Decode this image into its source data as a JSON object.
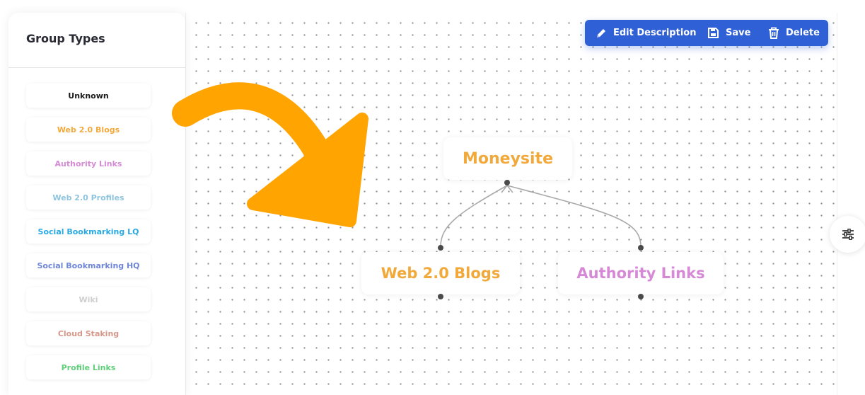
{
  "sidebar": {
    "title": "Group Types",
    "items": [
      {
        "label": "Unknown",
        "color": "#1a1a1a"
      },
      {
        "label": "Web 2.0 Blogs",
        "color": "#f2a93b"
      },
      {
        "label": "Authority Links",
        "color": "#d68ad6"
      },
      {
        "label": "Web 2.0 Profiles",
        "color": "#8ec4dd"
      },
      {
        "label": "Social Bookmarking LQ",
        "color": "#2aa9e0"
      },
      {
        "label": "Social Bookmarking HQ",
        "color": "#6f86d6"
      },
      {
        "label": "Wiki",
        "color": "#cfcfcf"
      },
      {
        "label": "Cloud Staking",
        "color": "#d4978a"
      },
      {
        "label": "Profile Links",
        "color": "#5fcf7a"
      }
    ]
  },
  "toolbar": {
    "edit_label": "Edit Description",
    "save_label": "Save",
    "delete_label": "Delete",
    "color": "#3060d6"
  },
  "nodes": {
    "moneysite": {
      "label": "Moneysite",
      "color": "#f2a93b"
    },
    "web20": {
      "label": "Web 2.0 Blogs",
      "color": "#f2a93b"
    },
    "authority": {
      "label": "Authority Links",
      "color": "#d68ad6"
    }
  },
  "icons": {
    "edit": "pencil-icon",
    "save": "save-icon",
    "delete": "trash-icon",
    "settings": "sliders-icon",
    "annotation": "curved-arrow-icon"
  },
  "annotation_arrow_color": "#ffa400"
}
